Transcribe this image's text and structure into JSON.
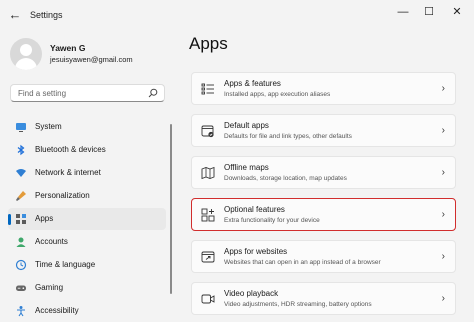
{
  "window": {
    "title": "Settings"
  },
  "profile": {
    "name": "Yawen G",
    "email": "jesuisyawen@gmail.com"
  },
  "search": {
    "placeholder": "Find a setting"
  },
  "sidebar": {
    "items": [
      {
        "label": "System",
        "icon": "monitor-icon"
      },
      {
        "label": "Bluetooth & devices",
        "icon": "bluetooth-icon"
      },
      {
        "label": "Network & internet",
        "icon": "wifi-icon"
      },
      {
        "label": "Personalization",
        "icon": "paintbrush-icon"
      },
      {
        "label": "Apps",
        "icon": "apps-icon",
        "active": true
      },
      {
        "label": "Accounts",
        "icon": "person-icon"
      },
      {
        "label": "Time & language",
        "icon": "globe-clock-icon"
      },
      {
        "label": "Gaming",
        "icon": "gamepad-icon"
      },
      {
        "label": "Accessibility",
        "icon": "accessibility-icon"
      }
    ]
  },
  "main": {
    "title": "Apps",
    "cards": [
      {
        "title": "Apps & features",
        "subtitle": "Installed apps, app execution aliases",
        "icon": "list-icon"
      },
      {
        "title": "Default apps",
        "subtitle": "Defaults for file and link types, other defaults",
        "icon": "default-apps-icon"
      },
      {
        "title": "Offline maps",
        "subtitle": "Downloads, storage location, map updates",
        "icon": "map-icon"
      },
      {
        "title": "Optional features",
        "subtitle": "Extra functionality for your device",
        "icon": "grid-plus-icon",
        "highlighted": true
      },
      {
        "title": "Apps for websites",
        "subtitle": "Websites that can open in an app instead of a browser",
        "icon": "web-app-icon"
      },
      {
        "title": "Video playback",
        "subtitle": "Video adjustments, HDR streaming, battery options",
        "icon": "video-icon"
      }
    ]
  },
  "colors": {
    "accent": "#0067c0",
    "highlight_border": "#d12d2d",
    "background": "#f3f3f3"
  }
}
